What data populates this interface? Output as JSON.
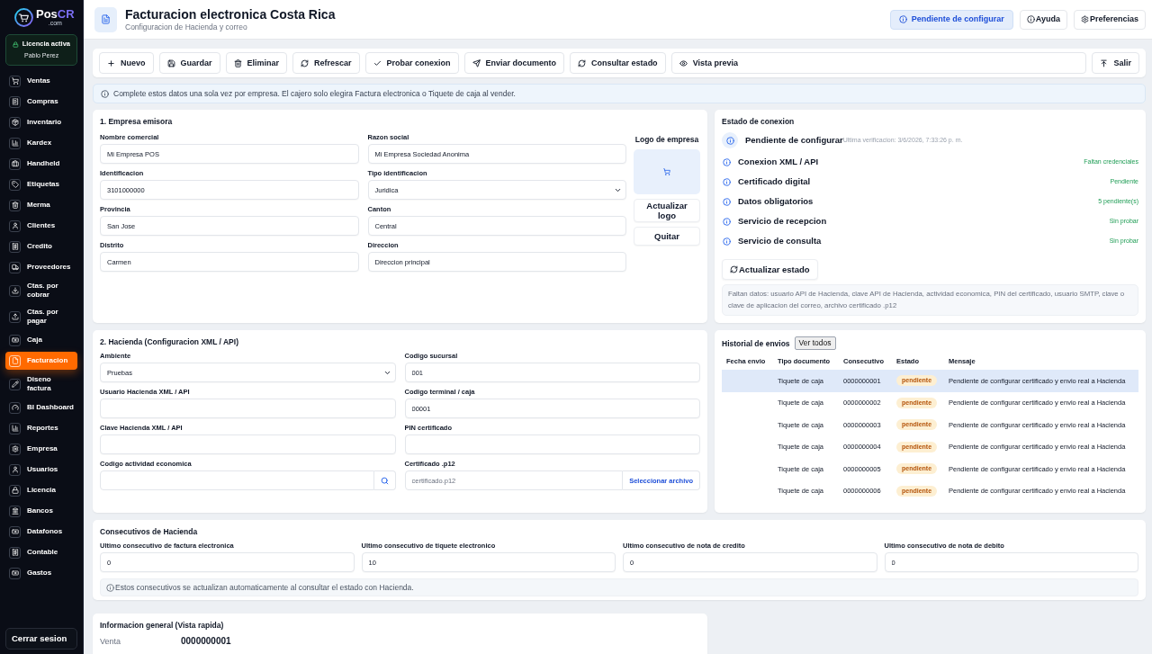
{
  "sidebar": {
    "brand": {
      "name": "Pos",
      "accent": "CR",
      "domain": ".com"
    },
    "license": {
      "title": "Licencia activa",
      "user": "Pablo Perez"
    },
    "items": [
      {
        "label": "Ventas",
        "selected": false
      },
      {
        "label": "Compras",
        "selected": false
      },
      {
        "label": "Inventario",
        "selected": false
      },
      {
        "label": "Kardex",
        "selected": false
      },
      {
        "label": "Handheld",
        "selected": false
      },
      {
        "label": "Etiquetas",
        "selected": false
      },
      {
        "label": "Merma",
        "selected": false
      },
      {
        "label": "Clientes",
        "selected": false
      },
      {
        "label": "Credito",
        "selected": false
      },
      {
        "label": "Proveedores",
        "selected": false
      },
      {
        "label": "Ctas. por cobrar",
        "selected": false
      },
      {
        "label": "Ctas. por pagar",
        "selected": false
      },
      {
        "label": "Caja",
        "selected": false
      },
      {
        "label": "Facturacion",
        "selected": true
      },
      {
        "label": "Diseno factura",
        "selected": false
      },
      {
        "label": "BI Dashboard",
        "selected": false
      },
      {
        "label": "Reportes",
        "selected": false
      },
      {
        "label": "Empresa",
        "selected": false
      },
      {
        "label": "Usuarios",
        "selected": false
      },
      {
        "label": "Licencia",
        "selected": false
      },
      {
        "label": "Bancos",
        "selected": false
      },
      {
        "label": "Datafonos",
        "selected": false
      },
      {
        "label": "Contable",
        "selected": false
      },
      {
        "label": "Gastos",
        "selected": false
      }
    ],
    "logout": "Cerrar sesion"
  },
  "header": {
    "title": "Facturacion electronica Costa Rica",
    "subtitle": "Configuracion de Hacienda y correo",
    "status": "Pendiente de configurar",
    "buttons": [
      "Ayuda",
      "Preferencias"
    ]
  },
  "toolbar": {
    "buttons": [
      "Nuevo",
      "Guardar",
      "Eliminar",
      "Refrescar",
      "Probar conexion",
      "Enviar documento",
      "Consultar estado",
      "Vista previa"
    ],
    "exit": "Salir"
  },
  "notice": "Complete estos datos una sola vez por empresa. El cajero solo elegira Factura electronica o Tiquete de caja al vender.",
  "empresa": {
    "title": "1. Empresa emisora",
    "fields": [
      {
        "label": "Nombre comercial",
        "value": "Mi Empresa POS",
        "kind": "text"
      },
      {
        "label": "Razon social",
        "value": "Mi Empresa Sociedad Anonima",
        "kind": "text"
      },
      {
        "label": "Identificacion",
        "value": "3101000000",
        "kind": "text"
      },
      {
        "label": "Tipo identificacion",
        "value": "Juridica",
        "kind": "select"
      },
      {
        "label": "Provincia",
        "value": "San Jose",
        "kind": "text"
      },
      {
        "label": "Canton",
        "value": "Central",
        "kind": "text"
      },
      {
        "label": "Distrito",
        "value": "Carmen",
        "kind": "text"
      },
      {
        "label": "Direccion",
        "value": "Direccion principal",
        "kind": "text"
      }
    ],
    "logo": {
      "title": "Logo de empresa",
      "buttons": [
        "Actualizar logo",
        "Quitar"
      ]
    }
  },
  "connection": {
    "title": "Estado de conexion",
    "status": "Pendiente de configurar",
    "last_check": "Ultima verificacion: 3/6/2026, 7:33:26 p. m.",
    "checks": [
      {
        "name": "Conexion XML / API",
        "result": "Faltan credenciales"
      },
      {
        "name": "Certificado digital",
        "result": "Pendiente"
      },
      {
        "name": "Datos obligatorios",
        "result": "5 pendiente(s)"
      },
      {
        "name": "Servicio de recepcion",
        "result": "Sin probar"
      },
      {
        "name": "Servicio de consulta",
        "result": "Sin probar"
      }
    ],
    "refresh_button": "Actualizar estado",
    "missing": "Faltan datos: usuario API de Hacienda, clave API de Hacienda, actividad economica, PIN del certificado, usuario SMTP, clave o clave de aplicacion del correo, archivo certificado .p12"
  },
  "hacienda": {
    "title": "2. Hacienda (Configuracion XML / API)",
    "fields": [
      {
        "label": "Ambiente",
        "value": "Pruebas",
        "kind": "select"
      },
      {
        "label": "Codigo sucursal",
        "value": "001",
        "kind": "text"
      },
      {
        "label": "Usuario Hacienda XML / API",
        "kind": "text"
      },
      {
        "label": "Codigo terminal / caja",
        "value": "00001",
        "kind": "text"
      },
      {
        "label": "Clave Hacienda XML / API",
        "kind": "text"
      },
      {
        "label": "PIN certificado",
        "kind": "text"
      },
      {
        "label": "Codigo actividad economica",
        "kind": "search"
      },
      {
        "label": "Certificado .p12",
        "placeholder": "certificado.p12",
        "kind": "file",
        "button": "Seleccionar archivo"
      }
    ]
  },
  "history": {
    "title": "Historial de envios",
    "button": "Ver todos",
    "columns": [
      "Fecha envio",
      "Tipo documento",
      "Consecutivo",
      "Estado",
      "Mensaje"
    ],
    "rows": [
      {
        "tipo_documento": "Tiquete de caja",
        "consecutivo": "0000000001",
        "estado": "pendiente",
        "mensaje": "Pendiente de configurar certificado y envio real a Hacienda",
        "selected": true
      },
      {
        "tipo_documento": "Tiquete de caja",
        "consecutivo": "0000000002",
        "estado": "pendiente",
        "mensaje": "Pendiente de configurar certificado y envio real a Hacienda",
        "selected": false
      },
      {
        "tipo_documento": "Tiquete de caja",
        "consecutivo": "0000000003",
        "estado": "pendiente",
        "mensaje": "Pendiente de configurar certificado y envio real a Hacienda",
        "selected": false
      },
      {
        "tipo_documento": "Tiquete de caja",
        "consecutivo": "0000000004",
        "estado": "pendiente",
        "mensaje": "Pendiente de configurar certificado y envio real a Hacienda",
        "selected": false
      },
      {
        "tipo_documento": "Tiquete de caja",
        "consecutivo": "0000000005",
        "estado": "pendiente",
        "mensaje": "Pendiente de configurar certificado y envio real a Hacienda",
        "selected": false
      },
      {
        "tipo_documento": "Tiquete de caja",
        "consecutivo": "0000000006",
        "estado": "pendiente",
        "mensaje": "Pendiente de configurar certificado y envio real a Hacienda",
        "selected": false
      }
    ]
  },
  "consecutivos": {
    "title": "Consecutivos de Hacienda",
    "fields": [
      {
        "label": "Ultimo consecutivo de factura electronica",
        "value": "0"
      },
      {
        "label": "Ultimo consecutivo de tiquete electronico",
        "value": "10"
      },
      {
        "label": "Ultimo consecutivo de nota de credito",
        "value": "0"
      },
      {
        "label": "Ultimo consecutivo de nota de debito",
        "value": "0"
      }
    ],
    "note": "Estos consecutivos se actualizan automaticamente al consultar el estado con Hacienda."
  },
  "overview": {
    "title": "Informacion general (Vista rapida)",
    "rows": [
      {
        "label": "Venta",
        "value": "0000000001"
      }
    ]
  }
}
